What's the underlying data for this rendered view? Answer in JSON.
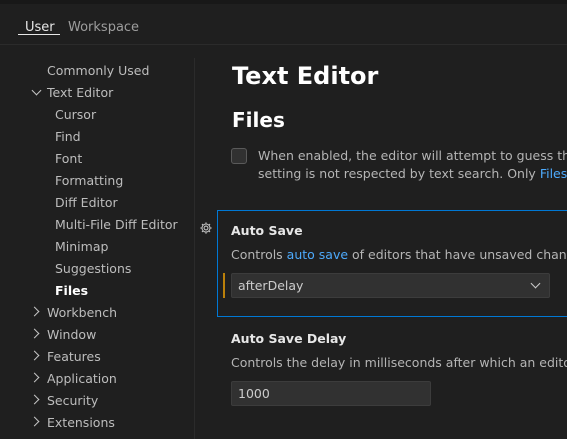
{
  "tabs": {
    "user": "User",
    "workspace": "Workspace"
  },
  "toc": {
    "commonly_used": "Commonly Used",
    "text_editor": "Text Editor",
    "text_editor_children": [
      "Cursor",
      "Find",
      "Font",
      "Formatting",
      "Diff Editor",
      "Multi-File Diff Editor",
      "Minimap",
      "Suggestions",
      "Files"
    ],
    "collapsed": [
      "Workbench",
      "Window",
      "Features",
      "Application",
      "Security",
      "Extensions"
    ]
  },
  "main": {
    "heading1": "Text Editor",
    "heading2": "Files",
    "partial_setting": {
      "line1": "When enabled, the editor will attempt to guess the ch",
      "line2_prefix": "setting is not respected by text search. Only ",
      "line2_link": "Files: Enc"
    },
    "auto_save": {
      "title": "Auto Save",
      "desc_prefix": "Controls ",
      "desc_link": "auto save",
      "desc_suffix": " of editors that have unsaved changes.",
      "value": "afterDelay"
    },
    "auto_save_delay": {
      "title": "Auto Save Delay",
      "desc": "Controls the delay in milliseconds after which an editor wi",
      "value": "1000"
    }
  },
  "colors": {
    "accent": "#0078d4",
    "link": "#4daafc",
    "modified": "#bb800a"
  }
}
